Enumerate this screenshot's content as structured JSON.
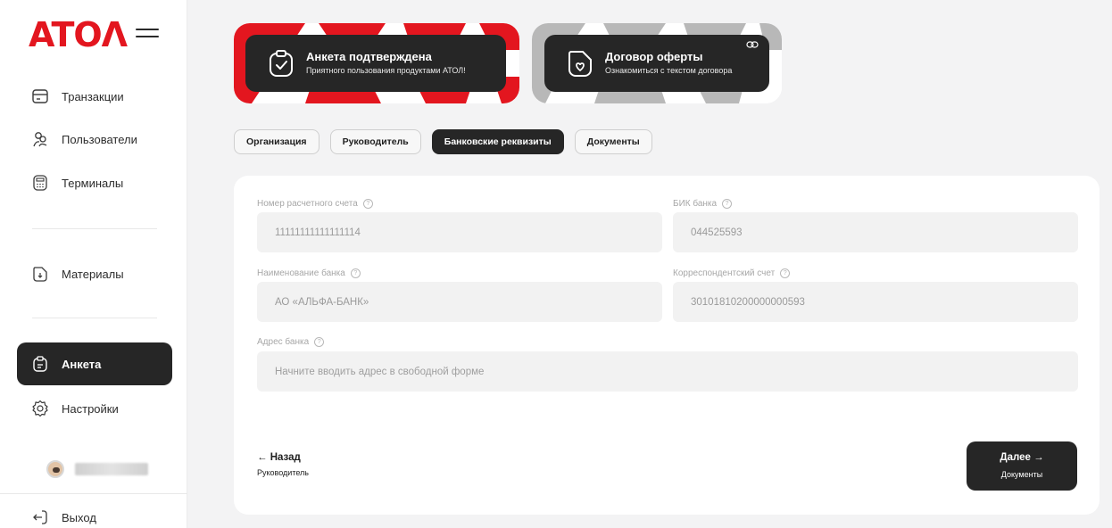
{
  "brand": {
    "logo_text": "ATOΛ",
    "accent": "#e3161f"
  },
  "sidebar": {
    "items": [
      {
        "label": "Транзакции",
        "icon": "card-icon"
      },
      {
        "label": "Пользователи",
        "icon": "users-icon"
      },
      {
        "label": "Терминалы",
        "icon": "terminal-icon"
      },
      {
        "label": "Материалы",
        "icon": "document-icon"
      },
      {
        "label": "Анкета",
        "icon": "clipboard-icon",
        "active": true
      },
      {
        "label": "Настройки",
        "icon": "gear-icon"
      }
    ],
    "logout_label": "Выход"
  },
  "banners": {
    "form": {
      "title": "Анкета подтверждена",
      "subtitle": "Приятного пользования продуктами АТОЛ!"
    },
    "offer": {
      "title": "Договор оферты",
      "subtitle": "Ознакомиться с текстом договора"
    }
  },
  "tabs": [
    {
      "label": "Организация",
      "active": false
    },
    {
      "label": "Руководитель",
      "active": false
    },
    {
      "label": "Банковские реквизиты",
      "active": true
    },
    {
      "label": "Документы",
      "active": false
    }
  ],
  "form": {
    "account": {
      "label": "Номер расчетного счета",
      "value": "11111111111111114"
    },
    "bik": {
      "label": "БИК банка",
      "value": "044525593"
    },
    "bank_name": {
      "label": "Наименование банка",
      "value": "АО «АЛЬФА-БАНК»"
    },
    "corr_account": {
      "label": "Корреспондентский счет",
      "value": "30101810200000000593"
    },
    "bank_address": {
      "label": "Адрес банка",
      "placeholder": "Начните вводить адрес в свободной форме"
    },
    "help_glyph": "?"
  },
  "navigation": {
    "back": {
      "title": "← Назад",
      "subtitle": "Руководитель"
    },
    "next": {
      "title": "Далее →",
      "subtitle": "Документы"
    }
  }
}
